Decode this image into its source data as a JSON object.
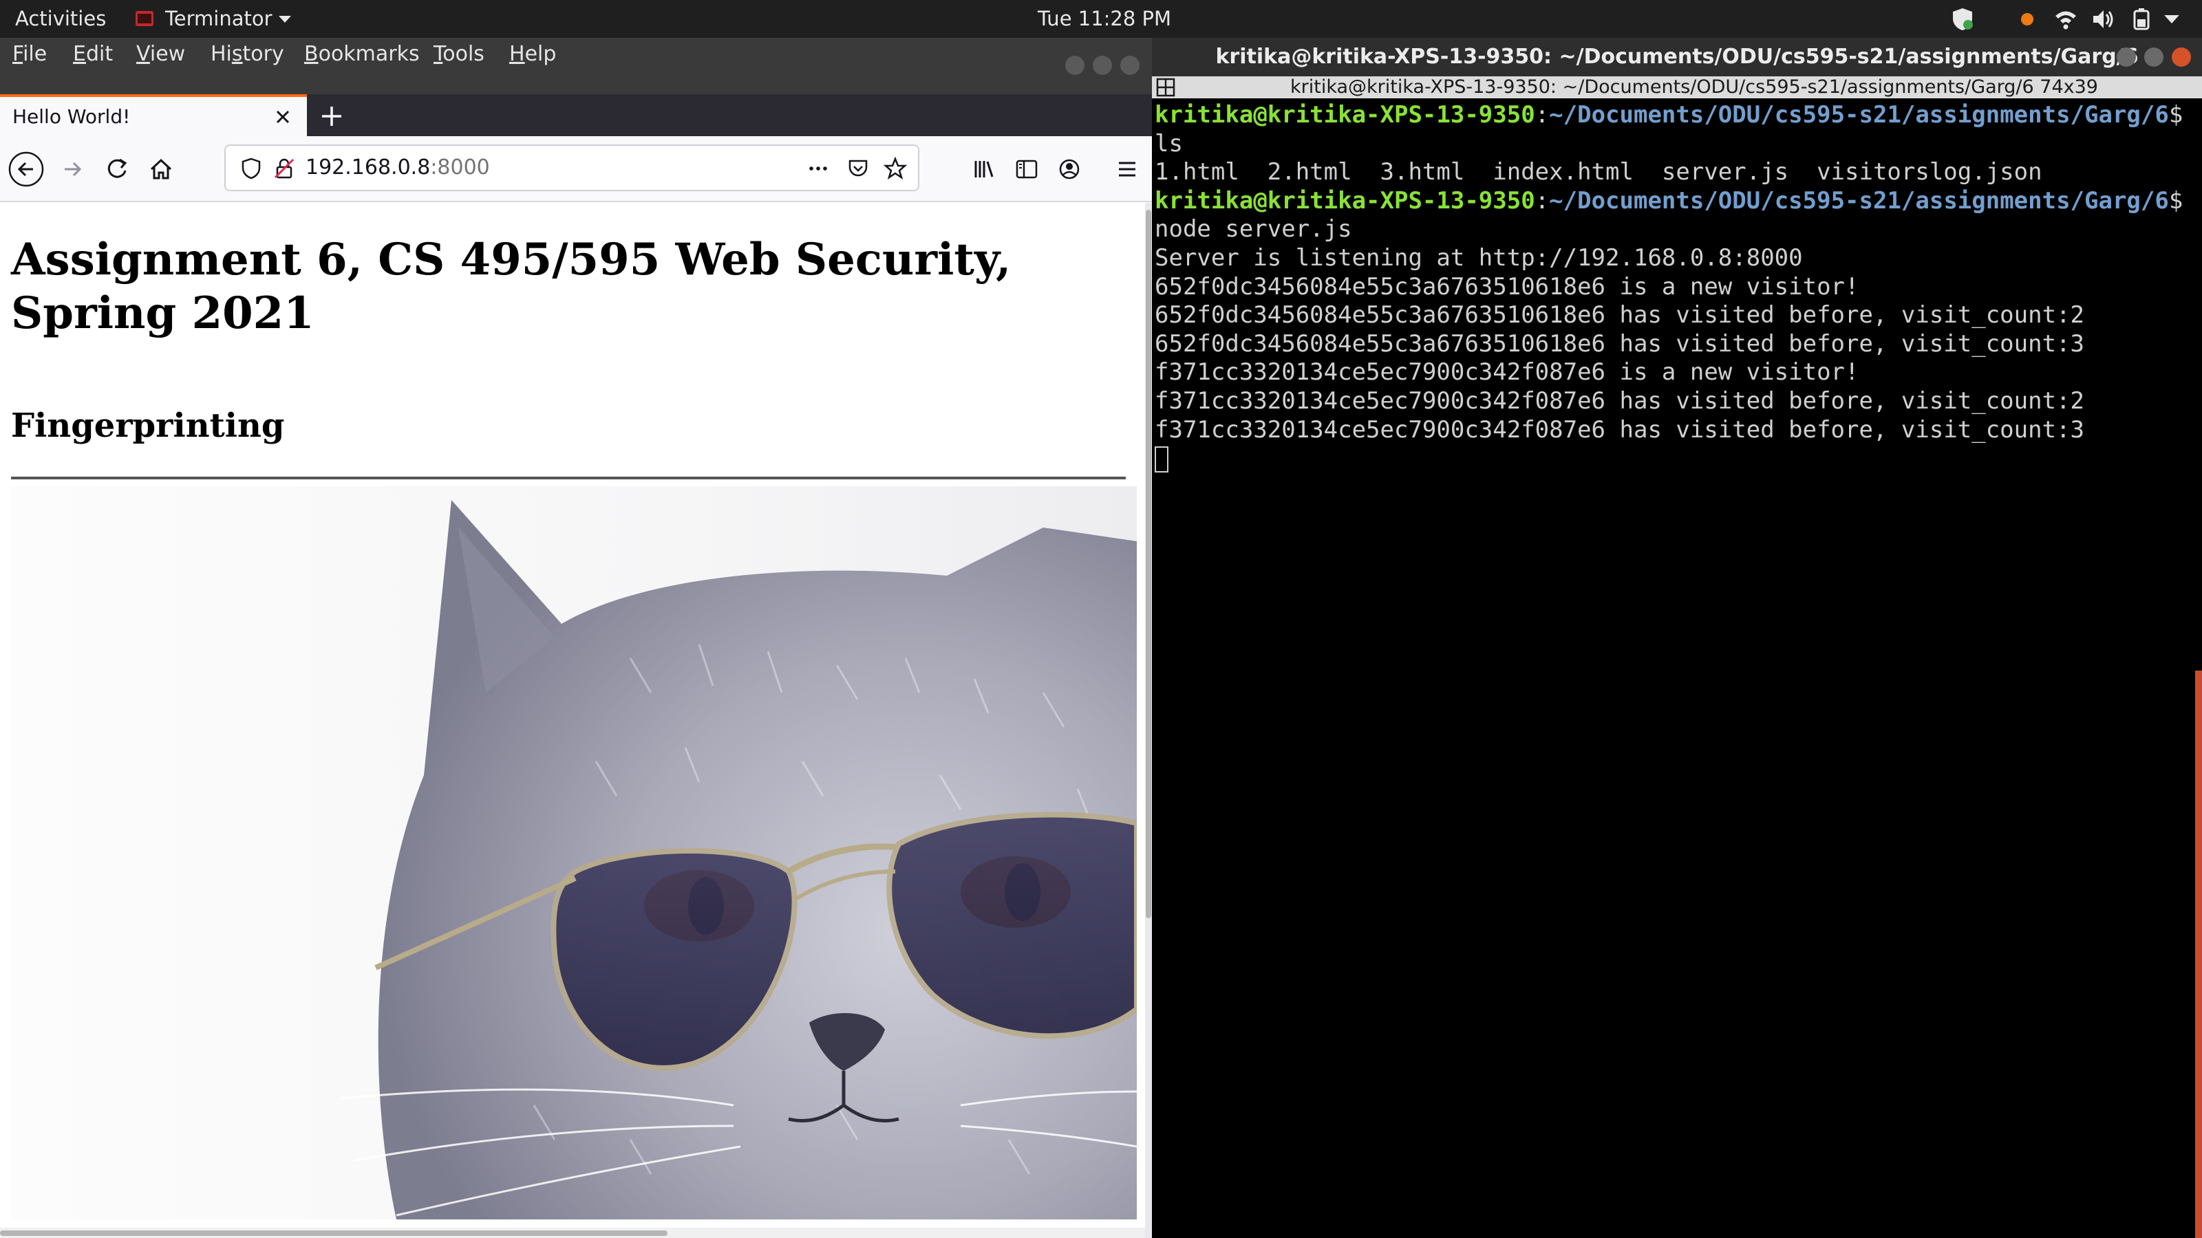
{
  "topbar": {
    "activities": "Activities",
    "app_name": "Terminator",
    "clock": "Tue 11:28 PM"
  },
  "firefox": {
    "menubar": [
      {
        "label": "File",
        "accel": "F"
      },
      {
        "label": "Edit",
        "accel": "E"
      },
      {
        "label": "View",
        "accel": "V"
      },
      {
        "label": "History",
        "accel": "s"
      },
      {
        "label": "Bookmarks",
        "accel": "B"
      },
      {
        "label": "Tools",
        "accel": "T"
      },
      {
        "label": "Help",
        "accel": "H"
      }
    ],
    "tab_title": "Hello World!",
    "url_host": "192.168.0.8",
    "url_port": ":8000",
    "page": {
      "h1": "Assignment 6, CS 495/595 Web Security, Spring 2021",
      "h2": "Fingerprinting"
    }
  },
  "terminal": {
    "title": "kritika@kritika-XPS-13-9350: ~/Documents/ODU/cs595-s21/assignments/Garg/6",
    "tab_label": "kritika@kritika-XPS-13-9350: ~/Documents/ODU/cs595-s21/assignments/Garg/6 74x39",
    "prompt_user": "kritika@kritika-XPS-13-9350",
    "prompt_path": "~/Documents/ODU/cs595-s21/assignments/Garg/6",
    "command1": "ls",
    "ls_output": "1.html  2.html  3.html  index.html  server.js  visitorslog.json",
    "command2": "node server.js",
    "output_lines": [
      "Server is listening at http://192.168.0.8:8000",
      "652f0dc3456084e55c3a6763510618e6 is a new visitor!",
      "652f0dc3456084e55c3a6763510618e6 has visited before, visit_count:2",
      "652f0dc3456084e55c3a6763510618e6 has visited before, visit_count:3",
      "f371cc3320134ce5ec7900c342f087e6 is a new visitor!",
      "f371cc3320134ce5ec7900c342f087e6 has visited before, visit_count:2",
      "f371cc3320134ce5ec7900c342f087e6 has visited before, visit_count:3"
    ]
  },
  "colors": {
    "prompt_user": "#8ae234",
    "prompt_path": "#729fcf",
    "tab_accent": "#ff6b1a"
  }
}
